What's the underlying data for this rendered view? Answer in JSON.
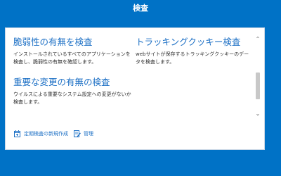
{
  "window": {
    "title": "検査",
    "crumb": "' ' '"
  },
  "cards": {
    "vulnerability": {
      "title": "脆弱性の有無を検査",
      "desc": "インストールされているすべてのアプリケーションを検査し、脆弱性の有無を確認します。"
    },
    "tracking_cookie": {
      "title": "トラッキングクッキー検査",
      "desc": "webサイトが保存するトラッキングクッキーのデータを検査します。"
    },
    "system_change": {
      "title": "重要な変更の有無の検査",
      "desc": "ウイルスによる重要なシステム設定への変更がないか検査します。"
    }
  },
  "actions": {
    "new_scheduled_label": "定期検査の新規作成",
    "manage_label": "管理"
  },
  "scrollbar": {
    "position": 0.75
  },
  "colors": {
    "background": "#0072c6",
    "link": "#1d70c5",
    "text": "#333333"
  },
  "icons": {
    "new_scheduled": "calendar-add-icon",
    "manage": "edit-document-icon"
  }
}
